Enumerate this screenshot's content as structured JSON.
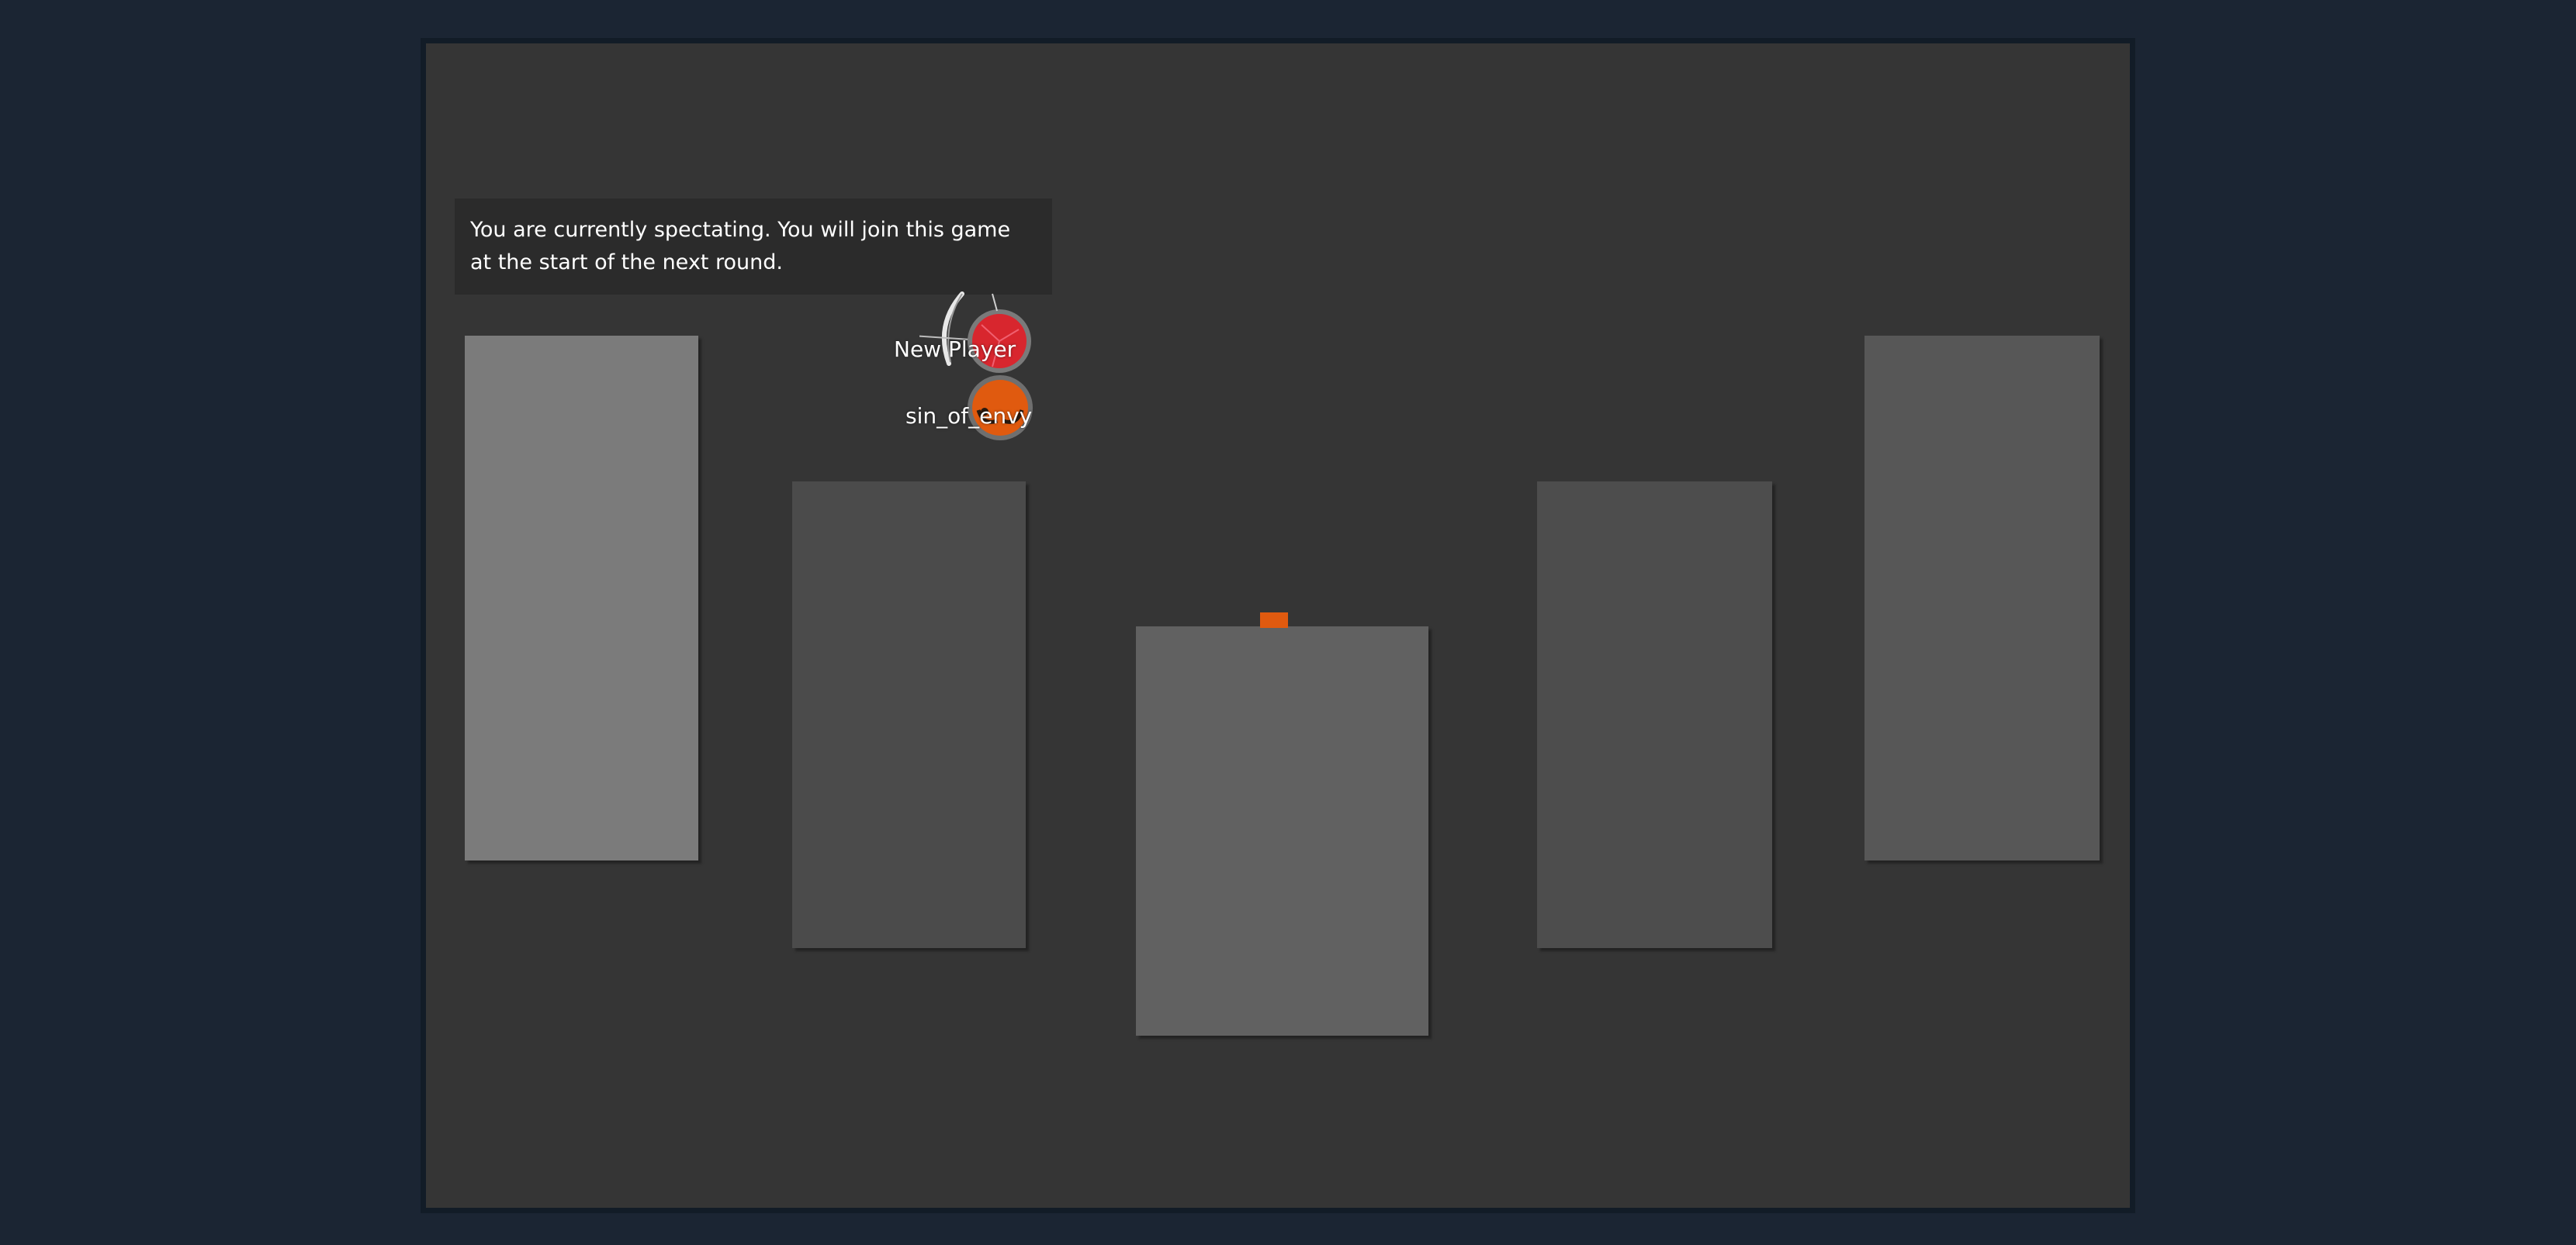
{
  "spectate_notice": "You are currently spectating. You will join this game at the start of the next round.",
  "players": [
    {
      "name": "New Player",
      "color": "#d8262e"
    },
    {
      "name": "sin_of_envy",
      "color": "#e05a0f"
    }
  ],
  "colors": {
    "background": "#1b2533",
    "board": "#353535",
    "flag": "#e05a0f"
  }
}
